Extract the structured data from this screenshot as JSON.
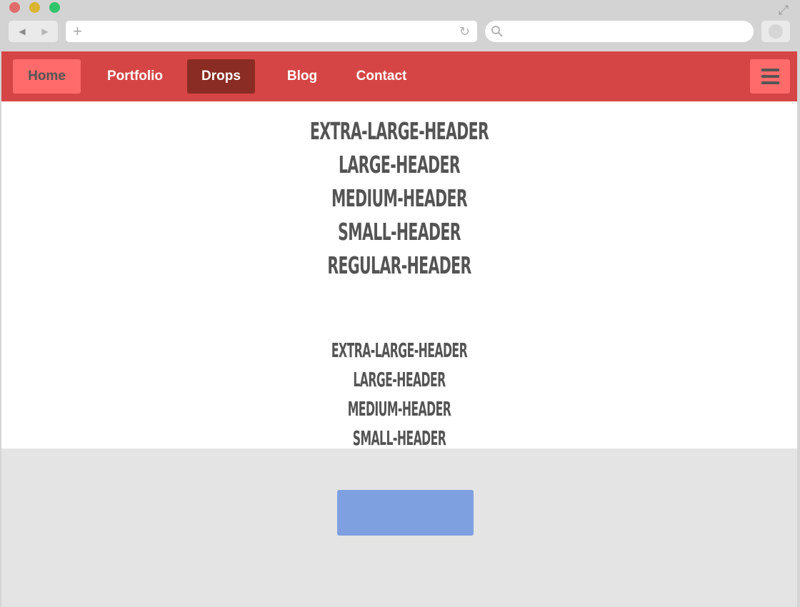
{
  "browser": {
    "address_value": "",
    "search_value": ""
  },
  "nav": {
    "items": [
      {
        "label": "Home"
      },
      {
        "label": "Portfolio"
      },
      {
        "label": "Drops"
      },
      {
        "label": "Blog"
      },
      {
        "label": "Contact"
      }
    ],
    "menu_icon": "hamburger-menu-icon"
  },
  "headers_set_1": [
    "extra-large-header",
    "large-header",
    "medium-header",
    "small-header",
    "regular-header"
  ],
  "headers_set_2": [
    "extra-large-header",
    "large-header",
    "medium-header",
    "small-header"
  ],
  "footer": {
    "button_label": ""
  },
  "colors": {
    "nav_bg": "#d64545",
    "nav_active": "#ff6b6b",
    "nav_dark": "#8a2c23",
    "header_text": "#545454",
    "footer_bg": "#e4e4e4",
    "footer_button": "#7fa0e0"
  }
}
